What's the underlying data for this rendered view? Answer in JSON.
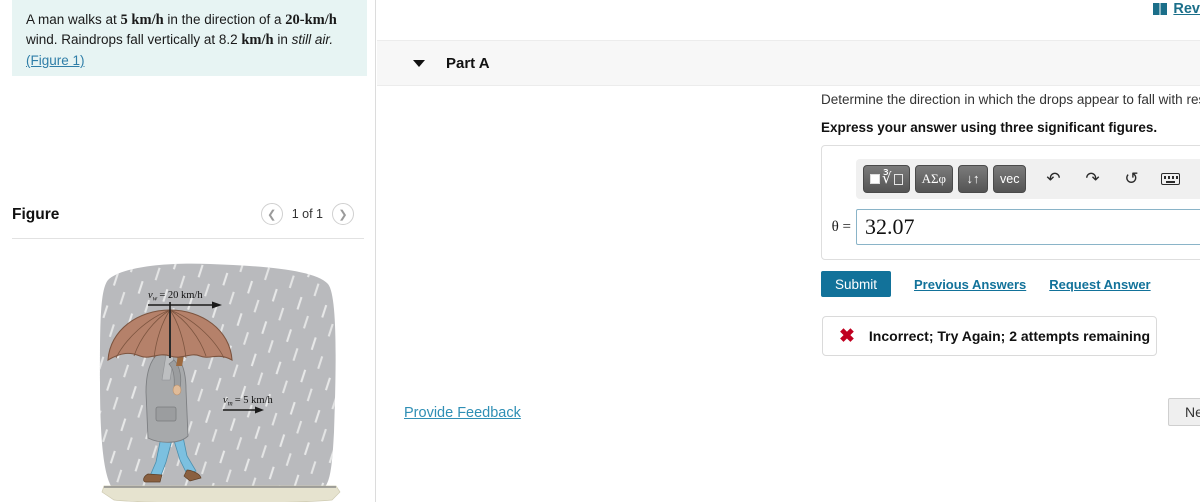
{
  "problem": {
    "line1_pre": "A man walks at ",
    "speed_man": "5 km/h",
    "line1_mid": " in the direction of a ",
    "speed_wind": "20-km/h",
    "line2_pre": "wind. Raindrops fall vertically at 8.2 ",
    "speed_rain": "km/h",
    "line2_mid": " in ",
    "still_air": "still air.",
    "figure_link": "(Figure 1)"
  },
  "figure": {
    "title": "Figure",
    "counter": "1 of 1",
    "prev_icon": "chevron-left-icon",
    "next_icon": "chevron-right-icon",
    "label_wind": "= 20 km/h",
    "label_wind_sub": "w",
    "label_man": "= 5 km/h",
    "label_man_sub": "m",
    "label_v": "v"
  },
  "review": {
    "label": "Rev",
    "icon": "book-icon"
  },
  "part": {
    "caret_icon": "caret-down-icon",
    "label": "Part A",
    "question": "Determine the direction in which the drops appear to fall with respect to the man, measured clockwise from the direction of the wind.",
    "instruction": "Express your answer using three significant figures."
  },
  "toolbar": {
    "buttons": [
      {
        "name": "template-button",
        "label": ""
      },
      {
        "name": "greek-button",
        "label": "ΑΣφ"
      },
      {
        "name": "updown-button",
        "label": "↓↑"
      },
      {
        "name": "vector-button",
        "label": "vec"
      }
    ],
    "icons": [
      {
        "name": "undo-icon",
        "glyph": "↶"
      },
      {
        "name": "redo-icon",
        "glyph": "↷"
      },
      {
        "name": "reset-icon",
        "glyph": "↺"
      },
      {
        "name": "keyboard-icon",
        "glyph": ""
      },
      {
        "name": "help-icon",
        "glyph": "?"
      }
    ]
  },
  "answer": {
    "variable": "θ =",
    "value": "32.07",
    "placeholder": "",
    "unit": "°"
  },
  "actions": {
    "submit": "Submit",
    "previous_answers": "Previous Answers",
    "request_answer": "Request Answer"
  },
  "feedback": {
    "icon": "x-mark-icon",
    "message": "Incorrect; Try Again; 2 attempts remaining"
  },
  "footer": {
    "provide_feedback": "Provide Feedback",
    "next": "Ne"
  },
  "colors": {
    "banner": "#e7f4f3",
    "link": "#2f7ea8",
    "submit": "#12729a",
    "error": "#c00020",
    "review": "#1b6f8a"
  }
}
